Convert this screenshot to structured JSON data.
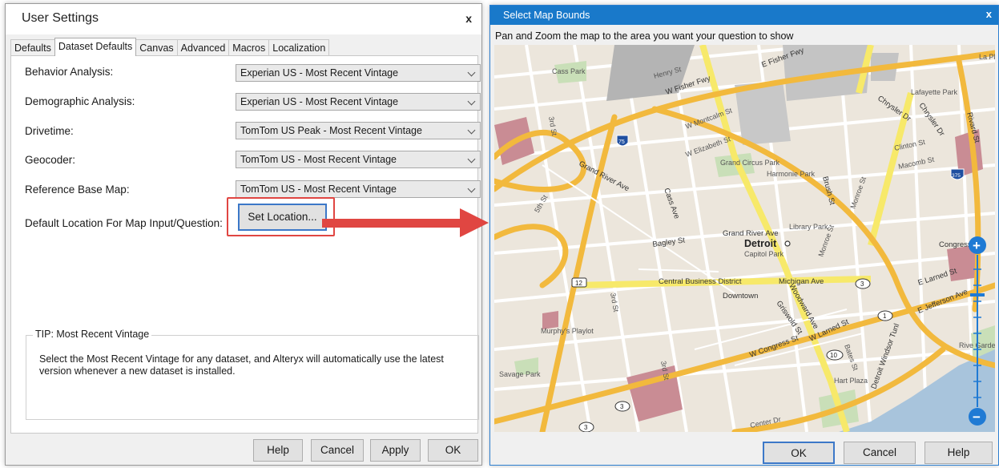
{
  "user_settings": {
    "title": "User Settings",
    "close": "x",
    "tabs": [
      "Defaults",
      "Dataset Defaults",
      "Canvas",
      "Advanced",
      "Macros",
      "Localization"
    ],
    "active_tab": "Dataset Defaults",
    "rows": [
      {
        "label": "Behavior Analysis:",
        "value": "Experian US - Most Recent Vintage"
      },
      {
        "label": "Demographic Analysis:",
        "value": "Experian US - Most Recent Vintage"
      },
      {
        "label": "Drivetime:",
        "value": "TomTom US Peak - Most Recent Vintage"
      },
      {
        "label": "Geocoder:",
        "value": "TomTom US - Most Recent Vintage"
      },
      {
        "label": "Reference Base Map:",
        "value": "TomTom US - Most Recent Vintage"
      }
    ],
    "default_location_label": "Default Location For Map Input/Question:",
    "set_location_button": "Set Location...",
    "tip_heading": "TIP: Most Recent Vintage",
    "tip_text": "Select the Most Recent Vintage for any dataset, and Alteryx will automatically use the latest version whenever a new dataset is installed.",
    "buttons": {
      "help": "Help",
      "cancel": "Cancel",
      "apply": "Apply",
      "ok": "OK"
    }
  },
  "map_bounds": {
    "title": "Select Map Bounds",
    "close": "x",
    "instruction": "Pan and Zoom the map to the area you want your question to show",
    "map_labels": {
      "city": "Detroit",
      "grand_river_ave_sign": "Grand River Ave",
      "capitol_park": "Capitol Park",
      "central_business_district": "Central Business District",
      "downtown": "Downtown",
      "michigan_ave": "Michigan Ave",
      "grand_river_ave": "Grand River Ave",
      "cass_ave": "Cass Ave",
      "bagley_st": "Bagley St",
      "third_st_a": "3rd St",
      "third_st_b": "3rd St",
      "third_st_c": "3rd St",
      "fifth_st": "5th St",
      "w_fisher_fwy": "W Fisher Fwy",
      "e_fisher_fwy": "E Fisher Fwy",
      "henry_st": "Henry St",
      "w_montcalm_st": "W Montcalm St",
      "w_elizabeth_st": "W Elizabeth St",
      "grand_circus_park": "Grand Circus Park",
      "harmonie_park": "Harmonie Park",
      "library_park": "Library Park",
      "brush_st": "Brush St",
      "monroe_st": "Monroe St",
      "monroe_st_2": "Monroe St",
      "chrysler_dr": "Chrysler Dr",
      "chrysler_dr_2": "Chrysler Dr",
      "lafayette_park": "Lafayette Park",
      "rivard_st": "Rivard St",
      "clinton_st": "Clinton St",
      "macomb_st": "Macomb St",
      "congress": "Congress",
      "e_larned_st": "E Larned St",
      "e_jefferson_ave": "E Jefferson Ave",
      "woodward_ave": "Woodward Ave",
      "griswold_st": "Griswold St",
      "w_congress_st": "W Congress St",
      "w_larned_st": "W Larned St",
      "bates_st": "Bates St",
      "detroit_windsor_tunl": "Detroit Windsor Tunl",
      "hart_plaza": "Hart Plaza",
      "murphys_playlot": "Murphy's Playlot",
      "savage_park": "Savage Park",
      "cass_park": "Cass Park",
      "center_dr": "Center Dr",
      "riverfront_gardens": "Rive Garde",
      "la_pla": "La Pla",
      "route_12": "12",
      "route_3a": "3",
      "route_3b": "3",
      "route_3c": "3",
      "route_1": "1",
      "route_10": "10",
      "route_75": "75",
      "route_375": "375"
    },
    "zoom_in": "+",
    "zoom_out": "−",
    "buttons": {
      "ok": "OK",
      "cancel": "Cancel",
      "help": "Help"
    }
  },
  "colors": {
    "title_bar_blue": "#1979ca",
    "highlight_red": "#e04642",
    "focus_blue": "#3c78c8",
    "freeway_orange": "#f2b93d",
    "major_road_yellow": "#f7e96a",
    "zoom_blue": "#1f7ad4"
  }
}
